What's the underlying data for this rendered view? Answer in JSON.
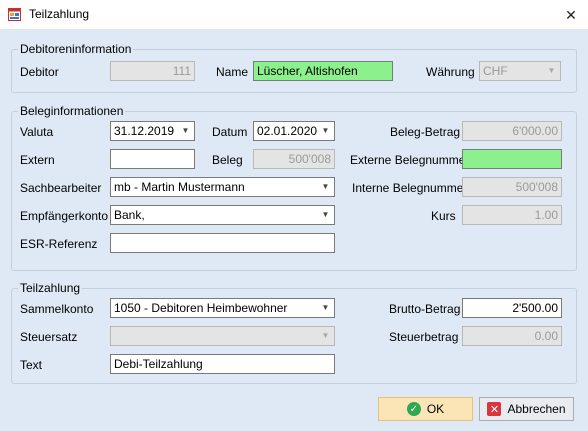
{
  "window": {
    "title": "Teilzahlung",
    "close_glyph": "✕"
  },
  "debitor_section": {
    "legend": "Debitoreninformation",
    "debitor_label": "Debitor",
    "debitor_value": "111",
    "name_label": "Name",
    "name_value": "Lüscher, Altishofen",
    "waehrung_label": "Währung",
    "waehrung_value": "CHF"
  },
  "beleg_section": {
    "legend": "Beleginformationen",
    "valuta_label": "Valuta",
    "valuta_value": "31.12.2019",
    "datum_label": "Datum",
    "datum_value": "02.01.2020",
    "beleg_betrag_label": "Beleg-Betrag",
    "beleg_betrag_value": "6'000.00",
    "extern_label": "Extern",
    "extern_value": "",
    "beleg_label": "Beleg",
    "beleg_value": "500'008",
    "externe_belegnummer_label": "Externe Belegnummer",
    "externe_belegnummer_value": "",
    "sachbearbeiter_label": "Sachbearbeiter",
    "sachbearbeiter_value": "mb - Martin Mustermann",
    "interne_belegnummer_label": "Interne Belegnummer",
    "interne_belegnummer_value": "500'008",
    "empfaengerkonto_label": "Empfängerkonto",
    "empfaengerkonto_value": "Bank,",
    "kurs_label": "Kurs",
    "kurs_value": "1.00",
    "esr_label": "ESR-Referenz",
    "esr_value": ""
  },
  "teilzahlung_section": {
    "legend": "Teilzahlung",
    "sammelkonto_label": "Sammelkonto",
    "sammelkonto_value": "1050 - Debitoren Heimbewohner",
    "brutto_label": "Brutto-Betrag",
    "brutto_value": "2'500.00",
    "steuersatz_label": "Steuersatz",
    "steuersatz_value": "",
    "steuerbetrag_label": "Steuerbetrag",
    "steuerbetrag_value": "0.00",
    "text_label": "Text",
    "text_value": "Debi-Teilzahlung"
  },
  "buttons": {
    "ok_label": "OK",
    "cancel_label": "Abbrechen"
  },
  "icons": {
    "app": "app-window-icon",
    "close": "close-icon",
    "ok": "check-circle-icon",
    "cancel": "x-square-icon",
    "dropdown": "chevron-down-icon"
  },
  "colors": {
    "client_bg": "#dfe9f5",
    "highlight_green": "#8cf08c",
    "ok_button_bg": "#fbe5b6",
    "ok_icon": "#2fa84f",
    "cancel_icon": "#d9363e"
  }
}
